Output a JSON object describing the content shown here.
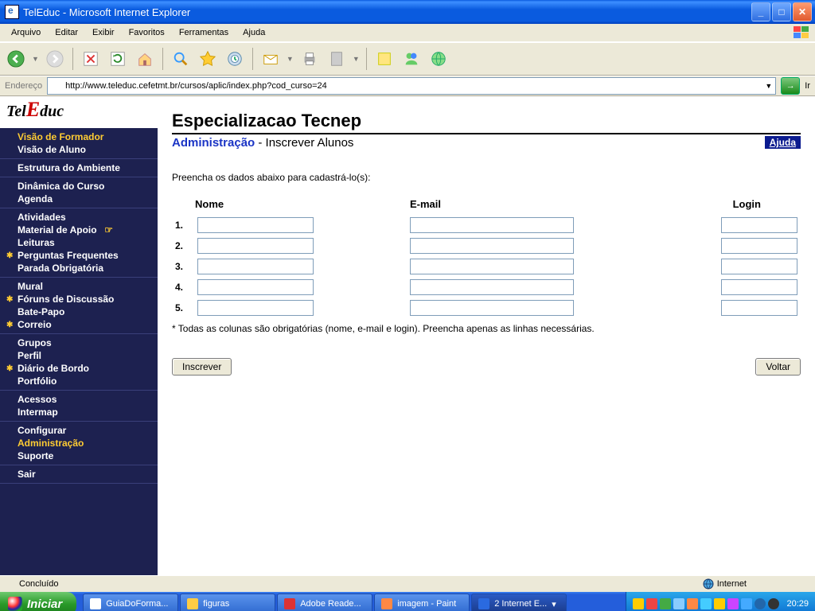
{
  "window": {
    "title": "TelEduc - Microsoft Internet Explorer"
  },
  "menubar": [
    "Arquivo",
    "Editar",
    "Exibir",
    "Favoritos",
    "Ferramentas",
    "Ajuda"
  ],
  "addressbar": {
    "label": "Endereço",
    "url": "http://www.teleduc.cefetmt.br/cursos/aplic/index.php?cod_curso=24",
    "go": "Ir"
  },
  "sidebar": {
    "logo": "TelEduc",
    "groups": [
      [
        {
          "label": "Visão de Formador",
          "gold": true
        },
        {
          "label": "Visão de Aluno"
        }
      ],
      [
        {
          "label": "Estrutura do Ambiente"
        }
      ],
      [
        {
          "label": "Dinâmica do Curso"
        },
        {
          "label": "Agenda"
        }
      ],
      [
        {
          "label": "Atividades"
        },
        {
          "label": "Material de Apoio",
          "hand": true
        },
        {
          "label": "Leituras"
        },
        {
          "label": "Perguntas Frequentes",
          "star": true
        },
        {
          "label": "Parada Obrigatória"
        }
      ],
      [
        {
          "label": "Mural"
        },
        {
          "label": "Fóruns de Discussão",
          "star": true
        },
        {
          "label": "Bate-Papo"
        },
        {
          "label": "Correio",
          "star": true
        }
      ],
      [
        {
          "label": "Grupos"
        },
        {
          "label": "Perfil"
        },
        {
          "label": "Diário de Bordo",
          "star": true
        },
        {
          "label": "Portfólio"
        }
      ],
      [
        {
          "label": "Acessos"
        },
        {
          "label": "Intermap"
        }
      ],
      [
        {
          "label": "Configurar"
        },
        {
          "label": "Administração",
          "gold": true
        },
        {
          "label": "Suporte"
        }
      ],
      [
        {
          "label": "Sair"
        }
      ]
    ]
  },
  "main": {
    "h1": "Especializacao Tecnep",
    "section": "Administração",
    "subsection": " - Inscrever Alunos",
    "help": "Ajuda",
    "instruction": "Preencha os dados abaixo para cadastrá-lo(s):",
    "columns": {
      "nome": "Nome",
      "email": "E-mail",
      "login": "Login"
    },
    "rows": [
      "1.",
      "2.",
      "3.",
      "4.",
      "5."
    ],
    "note": "* Todas as colunas são obrigatórias (nome, e-mail e login). Preencha apenas as linhas necessárias.",
    "submit": "Inscrever",
    "back": "Voltar"
  },
  "statusbar": {
    "done": "Concluído",
    "zone": "Internet"
  },
  "taskbar": {
    "start": "Iniciar",
    "tasks": [
      {
        "label": "GuiaDoForma..."
      },
      {
        "label": "figuras"
      },
      {
        "label": "Adobe Reade..."
      },
      {
        "label": "imagem - Paint"
      },
      {
        "label": "2 Internet E...",
        "active": true,
        "dd": true
      }
    ],
    "clock": "20:29"
  }
}
